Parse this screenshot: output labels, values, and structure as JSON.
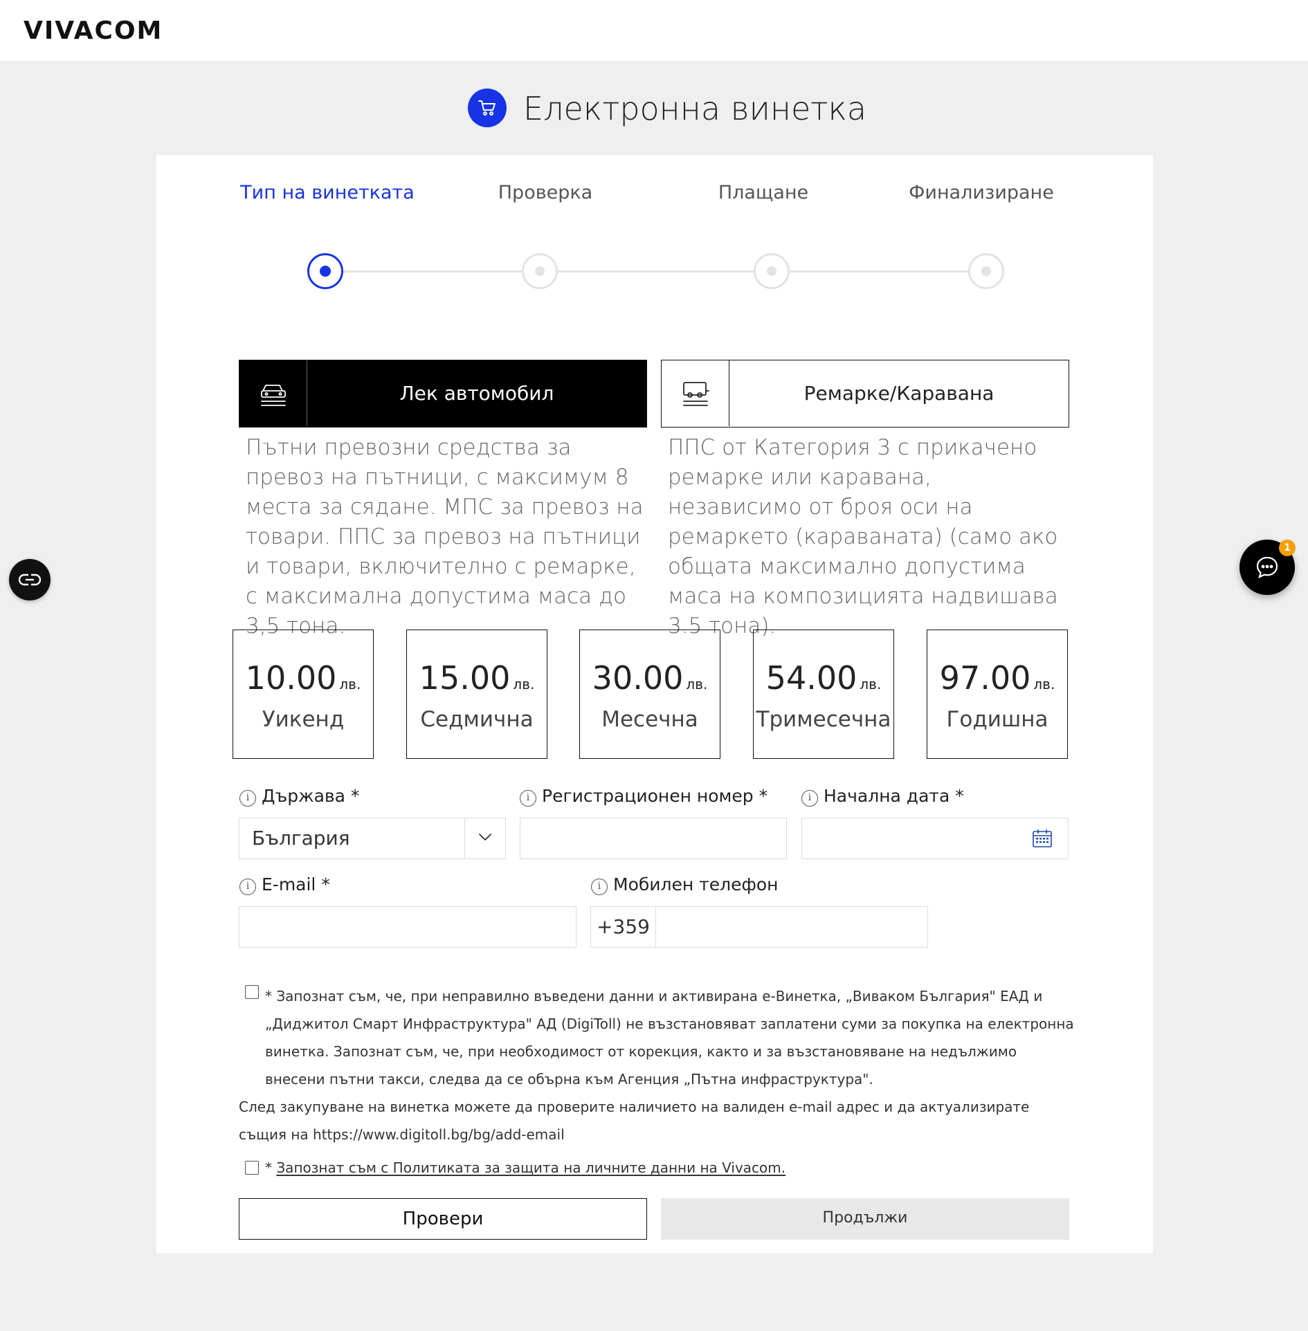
{
  "brand": {
    "logo_text": "VIVACOM",
    "accent_color": "#1633e6"
  },
  "page": {
    "title": "Електронна винетка",
    "title_icon": "cart-icon"
  },
  "steps": [
    {
      "label": "Тип на винетката",
      "active": true
    },
    {
      "label": "Проверка",
      "active": false
    },
    {
      "label": "Плащане",
      "active": false
    },
    {
      "label": "Финализиране",
      "active": false
    }
  ],
  "vehicle_types": [
    {
      "label": "Лек автомобил",
      "icon": "car-icon",
      "selected": true,
      "description": "Пътни превозни средства за превоз на пътници, с максимум 8 места за сядане. МПС за превоз на товари. ППС за превоз на пътници и товари, включително с ремарке, с максимална допустима маса до 3,5 тона."
    },
    {
      "label": "Ремарке/Каравана",
      "icon": "trailer-icon",
      "selected": false,
      "description": "ППС от Категория 3 с прикачено ремарке или каравана, независимо от броя оси на ремаркето (караваната) (само ако общата максимално допустима маса на композицията надвишава 3.5 тона)."
    }
  ],
  "prices": [
    {
      "amount": "10.00",
      "currency": "лв.",
      "label": "Уикенд"
    },
    {
      "amount": "15.00",
      "currency": "лв.",
      "label": "Седмична"
    },
    {
      "amount": "30.00",
      "currency": "лв.",
      "label": "Месечна"
    },
    {
      "amount": "54.00",
      "currency": "лв.",
      "label": "Тримесечна"
    },
    {
      "amount": "97.00",
      "currency": "лв.",
      "label": "Годишна"
    }
  ],
  "form": {
    "country": {
      "label": "Държава *",
      "value": "България"
    },
    "registration": {
      "label": "Регистрационен номер *",
      "value": ""
    },
    "start_date": {
      "label": "Начална дата *",
      "value": ""
    },
    "email": {
      "label": "E-mail *",
      "value": ""
    },
    "phone": {
      "label": "Мобилен телефон",
      "prefix": "+359",
      "value": ""
    },
    "info_glyph": "i"
  },
  "consents": {
    "terms_part1": "* Запознат съм, че, при неправилно въведени данни и активирана е-Винетка, „Вивaком България\" ЕАД и „Диджитол Смарт Инфраструктура\" АД (DigiToll) не възстановяват заплатени суми за покупка на електронна винетка. Запознат съм, че, при необходимост от корекция, както и за възстановяване на недължимо внесени пътни такси, следва да се обърна към Агенция „Пътна инфраструктура\".",
    "terms_part2": "След закупуване на винетка можете да проверите наличието на валиден e-mail адрес и да актуализирате същия на https://www.digitoll.bg/bg/add-email",
    "privacy_prefix": "* ",
    "privacy_link": "Запознат съм с Политиката за защита на личните данни на Vivacom."
  },
  "buttons": {
    "check": "Провери",
    "continue": "Продължи"
  },
  "floating": {
    "chat_badge_count": "1",
    "side_icon": "link-icon",
    "chat_icon": "chat-icon"
  }
}
